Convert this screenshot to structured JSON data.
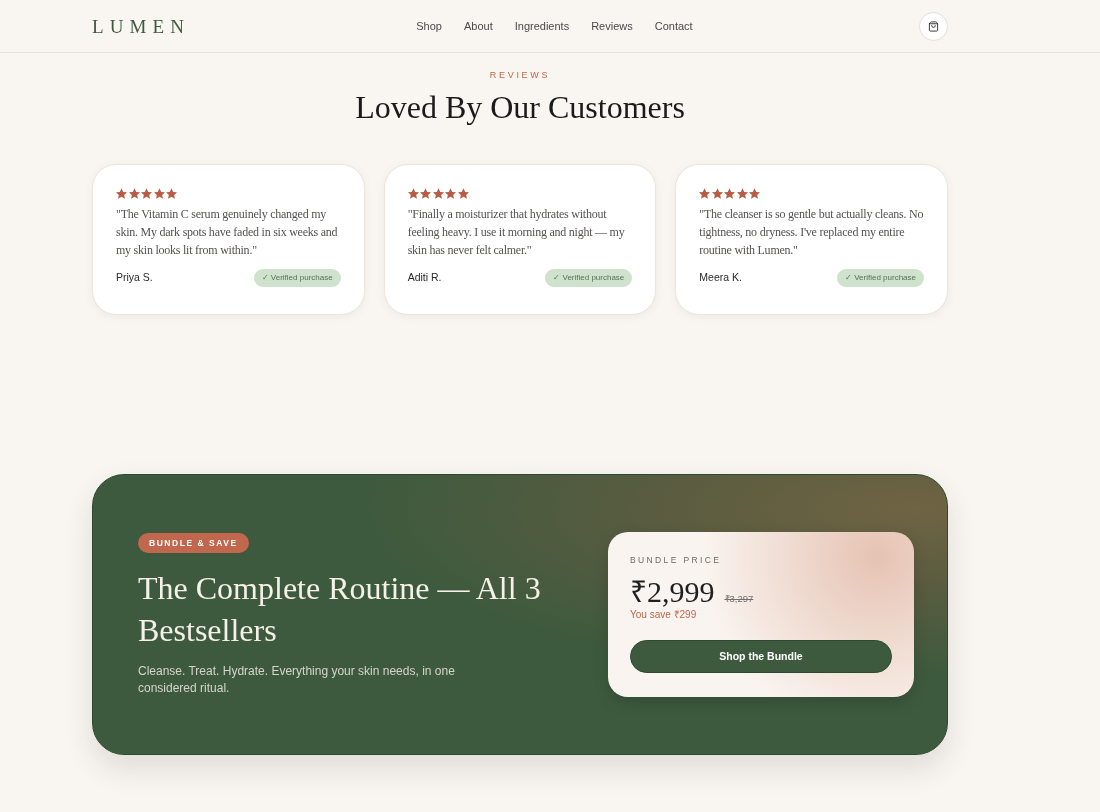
{
  "header": {
    "logo": "LUMEN",
    "nav": [
      "Shop",
      "About",
      "Ingredients",
      "Reviews",
      "Contact"
    ]
  },
  "reviews": {
    "eyebrow": "REVIEWS",
    "title": "Loved By Our Customers",
    "items": [
      {
        "stars": 5,
        "quote": "\"The Vitamin C serum genuinely changed my skin. My dark spots have faded in six weeks and my skin looks lit from within.\"",
        "author": "Priya S.",
        "badge": "✓ Verified purchase"
      },
      {
        "stars": 5,
        "quote": "\"Finally a moisturizer that hydrates without feeling heavy. I use it morning and night — my skin has never felt calmer.\"",
        "author": "Aditi R.",
        "badge": "✓ Verified purchase"
      },
      {
        "stars": 5,
        "quote": "\"The cleanser is so gentle but actually cleans. No tightness, no dryness. I've replaced my entire routine with Lumen.\"",
        "author": "Meera K.",
        "badge": "✓ Verified purchase"
      }
    ]
  },
  "bundle": {
    "badge": "BUNDLE & SAVE",
    "title": "The Complete Routine — All 3 Bestsellers",
    "description": "Cleanse. Treat. Hydrate. Everything your skin needs, in one considered ritual.",
    "price_card": {
      "label": "BUNDLE PRICE",
      "price": "₹2,999",
      "old_price": "₹3,297",
      "savings": "You save ₹299",
      "button": "Shop the Bundle"
    }
  }
}
